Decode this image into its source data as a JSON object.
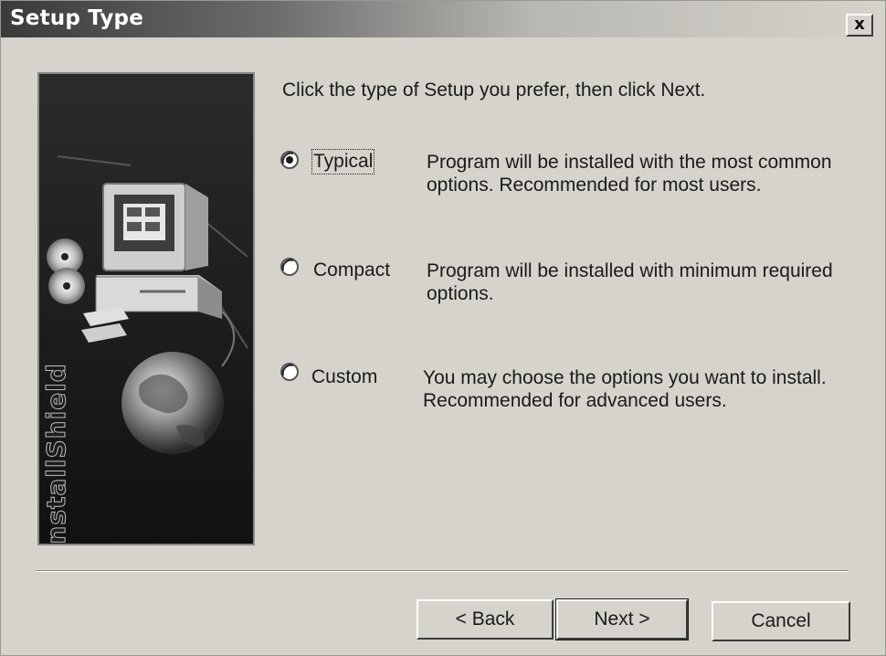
{
  "window": {
    "title": "Setup Type",
    "close_label": "x"
  },
  "image_panel": {
    "vertical_text": "InstallShield"
  },
  "prompt": "Click the type of Setup you prefer, then click Next.",
  "options": [
    {
      "label": "Typical",
      "selected": true,
      "desc_line1": "Program will be installed with the most common",
      "desc_line2": "options.  Recommended for most users."
    },
    {
      "label": "Compact",
      "selected": false,
      "desc_line1": "Program will be installed with minimum required",
      "desc_line2": "options."
    },
    {
      "label": "Custom",
      "selected": false,
      "desc_line1": "You may choose the options you want to install.",
      "desc_line2": "Recommended for advanced users."
    }
  ],
  "buttons": {
    "back": "< Back",
    "next": "Next >",
    "cancel": "Cancel"
  }
}
